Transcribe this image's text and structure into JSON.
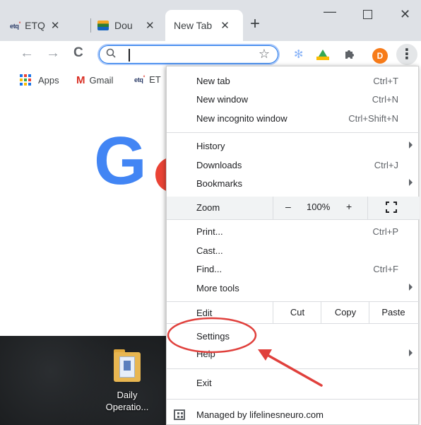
{
  "tabs": [
    {
      "favicon": "etq",
      "label": "ETQ",
      "close": "✕"
    },
    {
      "favicon": "stack-icon",
      "label": "Dou",
      "close": "✕"
    },
    {
      "label": "New Tab",
      "close": "✕",
      "active": true
    }
  ],
  "toolbar": {
    "new_tab_symbol": "+",
    "omnibox_value": "",
    "avatar_letter": "D",
    "avatar_color": "#f77b19"
  },
  "bookmarks": [
    {
      "label": "Apps",
      "icon": "apps-grid-icon"
    },
    {
      "label": "Gmail",
      "icon": "gmail-icon"
    },
    {
      "label": "ET",
      "icon": "etq-icon"
    }
  ],
  "page": {
    "logo_letter": "G"
  },
  "desktop": {
    "folder_label_line1": "Daily",
    "folder_label_line2": "Operatio..."
  },
  "menu": {
    "new_tab": {
      "label": "New tab",
      "shortcut": "Ctrl+T"
    },
    "new_window": {
      "label": "New window",
      "shortcut": "Ctrl+N"
    },
    "new_incognito": {
      "label": "New incognito window",
      "shortcut": "Ctrl+Shift+N"
    },
    "history": {
      "label": "History"
    },
    "downloads": {
      "label": "Downloads",
      "shortcut": "Ctrl+J"
    },
    "bookmarks": {
      "label": "Bookmarks"
    },
    "zoom": {
      "label": "Zoom",
      "minus": "–",
      "value": "100%",
      "plus": "+"
    },
    "print": {
      "label": "Print...",
      "shortcut": "Ctrl+P"
    },
    "cast": {
      "label": "Cast..."
    },
    "find": {
      "label": "Find...",
      "shortcut": "Ctrl+F"
    },
    "more_tools": {
      "label": "More tools"
    },
    "edit": {
      "label": "Edit",
      "cut": "Cut",
      "copy": "Copy",
      "paste": "Paste"
    },
    "settings": {
      "label": "Settings"
    },
    "help": {
      "label": "Help"
    },
    "exit": {
      "label": "Exit"
    },
    "managed": {
      "label": "Managed by lifelinesneuro.com"
    }
  },
  "colors": {
    "annotation_red": "#e0403c",
    "google_blue": "#4285f4"
  }
}
